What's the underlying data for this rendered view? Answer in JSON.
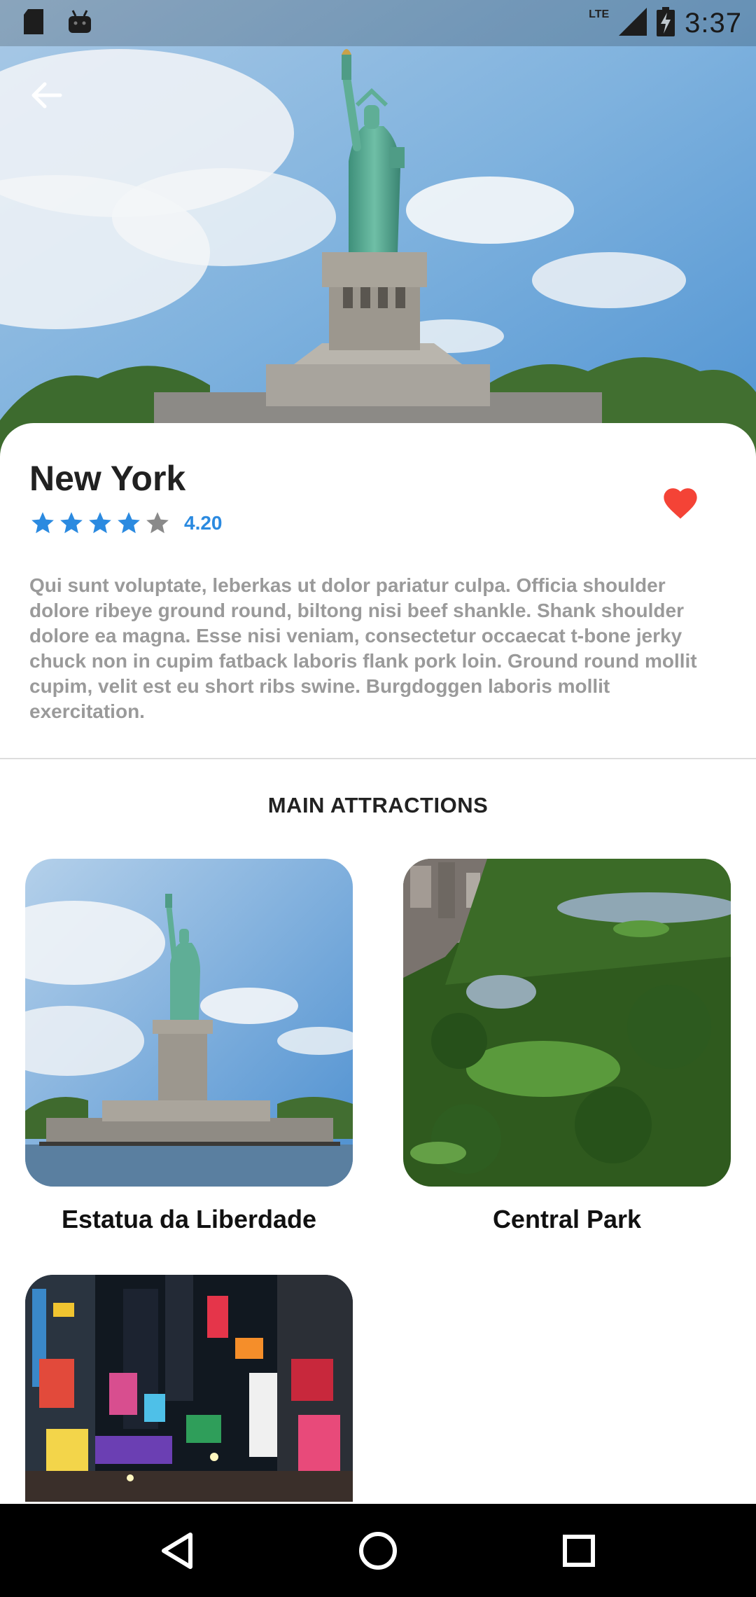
{
  "status_bar": {
    "network": "LTE",
    "time": "3:37",
    "icons": [
      "sd-card-icon",
      "android-icon",
      "signal-icon",
      "battery-charging-icon"
    ]
  },
  "header": {
    "back_icon": "arrow-left-icon",
    "hero_image": "statue-of-liberty-photo"
  },
  "city": {
    "title": "New York",
    "rating": 4.2,
    "rating_label": "4.20",
    "stars_total": 5,
    "stars_filled": 4,
    "favorite": true,
    "favorite_icon": "heart-icon",
    "description": "Qui sunt voluptate, leberkas ut dolor pariatur culpa. Officia shoulder dolore ribeye ground round, biltong nisi beef shankle. Shank shoulder dolore ea magna. Esse nisi veniam, consectetur occaecat t-bone jerky chuck non in cupim fatback laboris flank pork loin. Ground round mollit cupim, velit est eu short ribs swine. Burgdoggen laboris mollit exercitation."
  },
  "attractions": {
    "section_title": "MAIN ATTRACTIONS",
    "items": [
      {
        "label": "Estatua da Liberdade",
        "image": "statue-of-liberty-photo"
      },
      {
        "label": "Central Park",
        "image": "central-park-aerial-photo"
      },
      {
        "label": "",
        "image": "times-square-night-photo"
      }
    ]
  },
  "nav_bar": {
    "icons": [
      "back-triangle-icon",
      "home-circle-icon",
      "recents-square-icon"
    ]
  },
  "colors": {
    "accent": "#2b8ae0",
    "heart": "#f44336",
    "star_filled": "#2b8ae0",
    "star_empty": "#8a8a8a",
    "description_text": "#9a9a9a"
  }
}
